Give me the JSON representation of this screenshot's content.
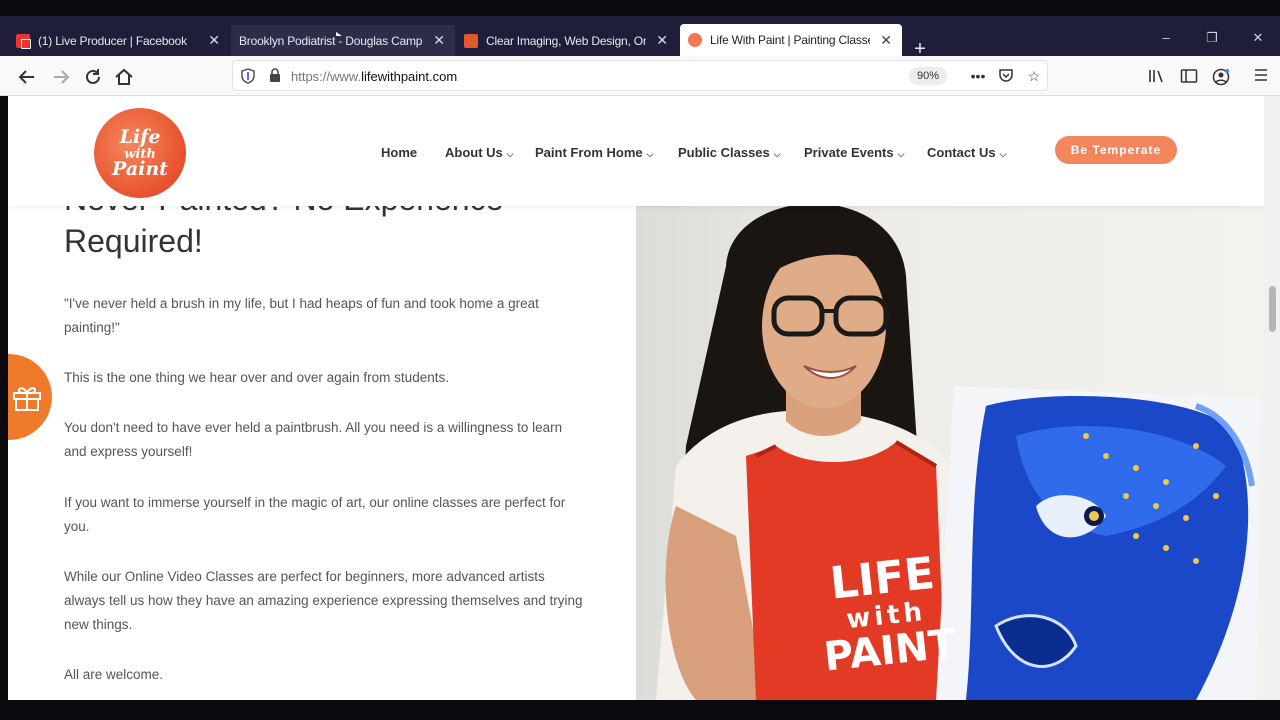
{
  "browser": {
    "tabs": [
      {
        "title": "(1) Live Producer | Facebook",
        "favicon": "facebook-icon",
        "state": "normal"
      },
      {
        "title": "Brooklyn Podiatrist - Douglas Camp",
        "favicon": "none",
        "state": "hover"
      },
      {
        "title": "Clear Imaging, Web Design, Onl",
        "favicon": "clear-imaging-icon",
        "state": "normal"
      },
      {
        "title": "Life With Paint | Painting Classe",
        "favicon": "lifewithpaint-icon",
        "state": "active"
      }
    ],
    "close_glyph": "✕",
    "new_tab_glyph": "+",
    "url_prefix": "https://www.",
    "url_domain": "lifewithpaint.com",
    "zoom": "90%",
    "window_controls": {
      "minimize": "–",
      "restore": "❐",
      "close": "✕"
    }
  },
  "site": {
    "logo": {
      "line1": "Life",
      "line2": "with",
      "line3": "Paint"
    },
    "menu": [
      {
        "label": "Home",
        "has_dropdown": false
      },
      {
        "label": "About Us",
        "has_dropdown": true
      },
      {
        "label": "Paint From Home",
        "has_dropdown": true
      },
      {
        "label": "Public Classes",
        "has_dropdown": true
      },
      {
        "label": "Private Events",
        "has_dropdown": true
      },
      {
        "label": "Contact Us",
        "has_dropdown": true
      }
    ],
    "chevron": "⌵",
    "cta_label": "Be Temperate",
    "heading_line1": "Never Painted? No Experience",
    "heading_line2": "Required!",
    "paragraphs": [
      "\"I've never held a brush in my life, but I had heaps of fun and took home a great painting!\"",
      "This is the one thing we hear over and over again from students.",
      "You don't need to have ever held a paintbrush. All you need is a willingness to learn and express yourself!",
      "If you want to immerse yourself in the magic of art, our online classes are perfect for you.",
      "While our Online Video Classes are perfect for beginners, more advanced artists always tell us how they have an amazing experience expressing themselves and trying new things.",
      "All are welcome."
    ],
    "apron": {
      "line1": "LIFE",
      "line2": "with",
      "line3": "PAINT"
    }
  },
  "colors": {
    "accent": "#f4865e",
    "gift_tab": "#f07a2c",
    "tabstrip": "#1f1e3a"
  }
}
